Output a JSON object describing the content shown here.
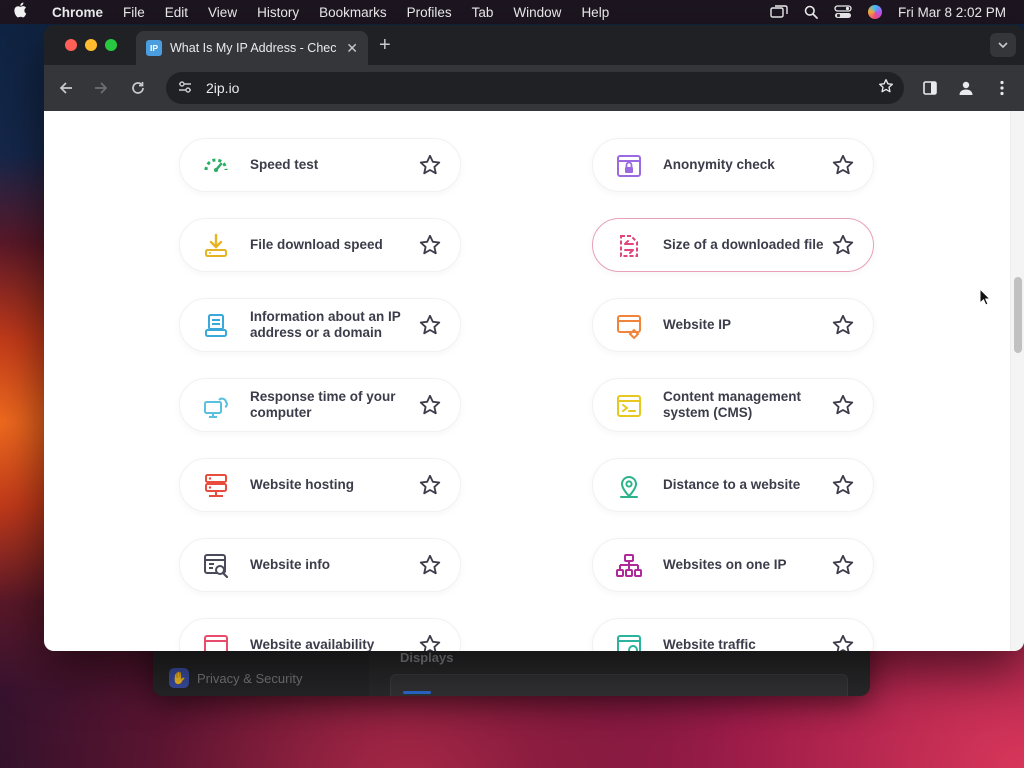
{
  "menubar": {
    "app": "Chrome",
    "items": [
      "File",
      "Edit",
      "View",
      "History",
      "Bookmarks",
      "Profiles",
      "Tab",
      "Window",
      "Help"
    ],
    "clock": "Fri Mar 8  2:02 PM"
  },
  "background_window": {
    "sidebar_item": "Privacy & Security",
    "section_title": "Displays"
  },
  "browser": {
    "tab": {
      "favicon": "IP",
      "title": "What Is My IP Address - Chec"
    },
    "url": "2ip.io"
  },
  "cards": [
    {
      "label": "Speed test",
      "icon": "speedometer-icon",
      "color": "#27ae60"
    },
    {
      "label": "Anonymity check",
      "icon": "lock-window-icon",
      "color": "#9b6ae0"
    },
    {
      "label": "File download speed",
      "icon": "download-icon",
      "color": "#e6b422"
    },
    {
      "label": "Size of a downloaded file",
      "icon": "file-size-icon",
      "color": "#e0457b",
      "active": true
    },
    {
      "label": "Information about an IP address or a domain",
      "icon": "document-stack-icon",
      "color": "#3aa8d8"
    },
    {
      "label": "Website IP",
      "icon": "website-link-icon",
      "color": "#f0843c"
    },
    {
      "label": "Response time of your computer",
      "icon": "computer-cloud-icon",
      "color": "#5bc0de"
    },
    {
      "label": "Content management system (CMS)",
      "icon": "terminal-window-icon",
      "color": "#e6c81e"
    },
    {
      "label": "Website hosting",
      "icon": "server-icon",
      "color": "#e74c3c"
    },
    {
      "label": "Distance to a website",
      "icon": "map-pin-icon",
      "color": "#2bb38a"
    },
    {
      "label": "Website info",
      "icon": "window-search-icon",
      "color": "#4a4a5a"
    },
    {
      "label": "Websites on one IP",
      "icon": "sitemap-icon",
      "color": "#b0299a"
    },
    {
      "label": "Website availability",
      "icon": "window-alert-icon",
      "color": "#e74c6c"
    },
    {
      "label": "Website traffic",
      "icon": "window-chart-icon",
      "color": "#2bb3a0"
    }
  ]
}
